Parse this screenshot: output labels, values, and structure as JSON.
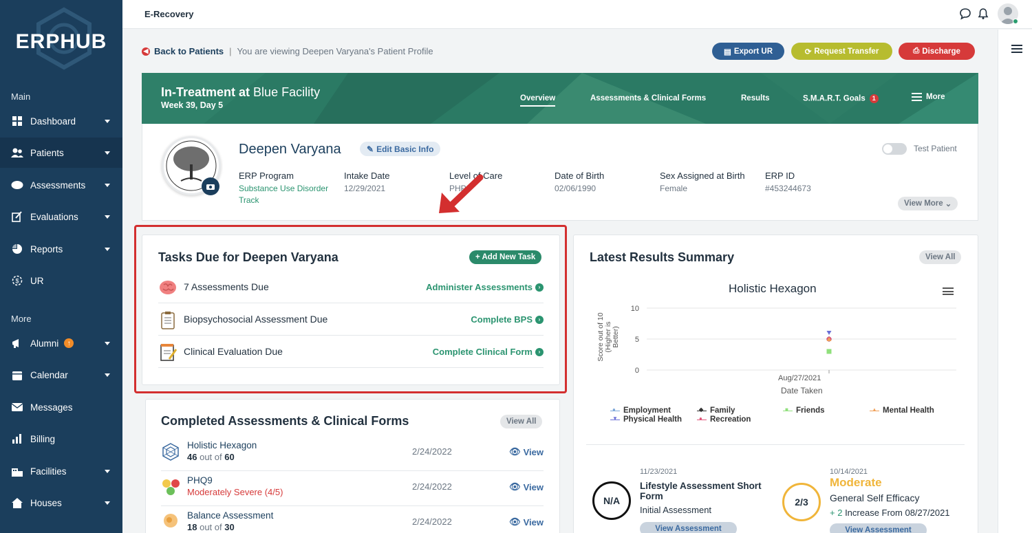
{
  "brand": {
    "name": "ERPHUB"
  },
  "topbar": {
    "title": "E-Recovery"
  },
  "sidebar": {
    "section_main": "Main",
    "section_more": "More",
    "items": [
      {
        "label": "Dashboard",
        "icon": "dashboard-icon"
      },
      {
        "label": "Patients",
        "icon": "patients-icon"
      },
      {
        "label": "Assessments",
        "icon": "assessments-icon"
      },
      {
        "label": "Evaluations",
        "icon": "evaluations-icon"
      },
      {
        "label": "Reports",
        "icon": "reports-icon"
      },
      {
        "label": "UR",
        "icon": "ur-icon"
      },
      {
        "label": "Alumni",
        "icon": "alumni-icon",
        "badge": "↑"
      },
      {
        "label": "Calendar",
        "icon": "calendar-icon"
      },
      {
        "label": "Messages",
        "icon": "messages-icon"
      },
      {
        "label": "Billing",
        "icon": "billing-icon"
      },
      {
        "label": "Facilities",
        "icon": "facilities-icon"
      },
      {
        "label": "Houses",
        "icon": "houses-icon"
      }
    ]
  },
  "breadcrumb": {
    "back": "Back to Patients",
    "separator": "|",
    "viewing": "You are viewing Deepen Varyana's Patient Profile"
  },
  "actions": {
    "export": "Export UR",
    "transfer": "Request Transfer",
    "discharge": "Discharge"
  },
  "band": {
    "status_bold": "In-Treatment at",
    "facility": "Blue Facility",
    "week": "Week 39, Day 5",
    "tabs": [
      "Overview",
      "Assessments & Clinical Forms",
      "Results",
      "S.M.A.R.T. Goals",
      "More"
    ],
    "goals_count": "1"
  },
  "profile": {
    "name": "Deepen Varyana",
    "edit": "Edit Basic Info",
    "test_patient": "Test Patient",
    "view_more": "View More",
    "fields": [
      {
        "label": "ERP Program",
        "value": "Substance Use Disorder Track"
      },
      {
        "label": "Intake Date",
        "value": "12/29/2021"
      },
      {
        "label": "Level of Care",
        "value": "PHP"
      },
      {
        "label": "Date of Birth",
        "value": "02/06/1990"
      },
      {
        "label": "Sex Assigned at Birth",
        "value": "Female"
      },
      {
        "label": "ERP ID",
        "value": "#453244673"
      }
    ]
  },
  "tasks": {
    "title": "Tasks Due for Deepen Varyana",
    "add": "+ Add New Task",
    "rows": [
      {
        "text": "7 Assessments Due",
        "link": "Administer Assessments"
      },
      {
        "text": "Biopsychosocial Assessment Due",
        "link": "Complete BPS"
      },
      {
        "text": "Clinical Evaluation Due",
        "link": "Complete Clinical Form"
      }
    ]
  },
  "completed": {
    "title": "Completed Assessments & Clinical Forms",
    "view_all": "View All",
    "rows": [
      {
        "name": "Holistic Hexagon",
        "score": "46",
        "of": "out of",
        "total": "60",
        "date": "2/24/2022",
        "view": "View"
      },
      {
        "name": "PHQ9",
        "result": "Moderately Severe (4/5)",
        "date": "2/24/2022",
        "view": "View"
      },
      {
        "name": "Balance Assessment",
        "score": "18",
        "of": "out of",
        "total": "30",
        "date": "2/24/2022",
        "view": "View"
      }
    ]
  },
  "results": {
    "title": "Latest Results Summary",
    "view_all": "View All",
    "chart_title": "Holistic Hexagon",
    "items": [
      {
        "date": "11/23/2021",
        "circle": "N/A",
        "name": "Lifestyle Assessment Short Form",
        "sub": "Initial Assessment",
        "button": "View Assessment"
      },
      {
        "date": "10/14/2021",
        "circle": "2/3",
        "level": "Moderate",
        "name": "General Self Efficacy",
        "change": "+ 2",
        "change_text": "Increase From 08/27/2021",
        "button": "View Assessment"
      }
    ]
  },
  "colors": {
    "sidebar": "#1b3e5c",
    "band": "#2b7a64",
    "accent_green": "#2b9470",
    "export": "#2f5f94",
    "transfer": "#b7bc2f",
    "discharge": "#d63a3a",
    "highlight": "#d32f2f"
  },
  "chart_data": {
    "type": "scatter",
    "title": "Holistic Hexagon",
    "xlabel": "Date Taken",
    "ylabel": "Score out of 10 (Higher is Better)",
    "categories": [
      "Aug/27/2021"
    ],
    "ylim": [
      0,
      10
    ],
    "yticks": [
      "0",
      "5",
      "10"
    ],
    "series": [
      {
        "name": "Employment",
        "values": [
          5
        ],
        "color": "#7da7d9"
      },
      {
        "name": "Physical Health",
        "values": [
          6
        ],
        "color": "#6a6fd6"
      },
      {
        "name": "Family",
        "values": [
          5
        ],
        "color": "#333333"
      },
      {
        "name": "Recreation",
        "values": [
          5
        ],
        "color": "#e0567a"
      },
      {
        "name": "Friends",
        "values": [
          3
        ],
        "color": "#90e07c"
      },
      {
        "name": "Mental Health",
        "values": [
          5
        ],
        "color": "#f0a05a"
      }
    ]
  }
}
